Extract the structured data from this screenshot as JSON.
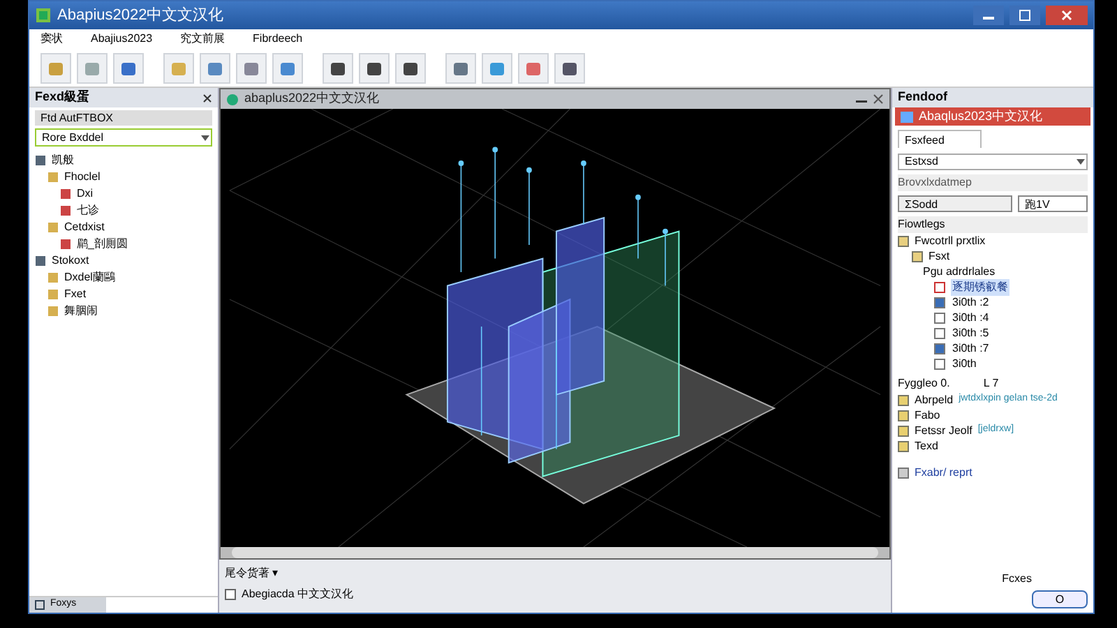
{
  "window": {
    "title": "Abapius2022中文文汉化"
  },
  "menu": [
    "窦状",
    "Abajius2023",
    "究文前展",
    "Fibrdeech"
  ],
  "left_panel": {
    "title": "Fexd級蛋",
    "filter": "Ftd AutFTBOX",
    "dropdown": "Rore Bxddel",
    "tree": [
      {
        "label": "凯般",
        "children": [
          {
            "label": "Fhoclel",
            "children": [
              {
                "label": "Dxi"
              },
              {
                "label": "七诊"
              }
            ]
          },
          {
            "label": "Cetdxist",
            "children": [
              {
                "label": "鹛_剖厠圆"
              }
            ]
          }
        ]
      },
      {
        "label": "Stokoxt",
        "children": [
          {
            "label": "Dxdel蘭鷗"
          },
          {
            "label": "Fxet"
          },
          {
            "label": "舞胭闹"
          }
        ]
      }
    ],
    "bottom_tab": "Foxys"
  },
  "viewport": {
    "title": "abaplus2022中文文汉化",
    "command": "尾令货著 ▾",
    "status": "Abegiacda 中文文汉化"
  },
  "right_panel": {
    "title": "Fendoof",
    "subwindow": "Abaqlus2023中文汉化",
    "tab": "Fsxfeed",
    "dropdown": "Estxsd",
    "label": "Brovxlxdatmep",
    "field": "ΣSodd",
    "field_2": "跑1V",
    "section": "Fiowtlegs",
    "tree_root": "Fwcotrll prxtlix",
    "folder": "Fsxt",
    "group": "Pgu adrdrlales",
    "items": [
      {
        "label": "逐期锈叡餐",
        "checked": false,
        "selected": true
      },
      {
        "label": "3i0th :2",
        "checked": true,
        "selected": false
      },
      {
        "label": "3i0th :4",
        "checked": false,
        "selected": false
      },
      {
        "label": "3i0th :5",
        "checked": false,
        "selected": false
      },
      {
        "label": "3i0th :7",
        "checked": true,
        "selected": false
      },
      {
        "label": "3i0th",
        "checked": false,
        "selected": false
      }
    ],
    "range": [
      "Fyggleo 0.",
      "L 7"
    ],
    "props": [
      {
        "label": "Abrpeld",
        "value": "jwtdxlxpin gelan tse-2d"
      },
      {
        "label": "Fabo"
      },
      {
        "label": "Fetssr Jeolf",
        "value": "[jeldrxw]"
      },
      {
        "label": "Texd"
      }
    ],
    "report": "Fxabr/ reprt",
    "footer": "Fcxes",
    "button": "O"
  }
}
